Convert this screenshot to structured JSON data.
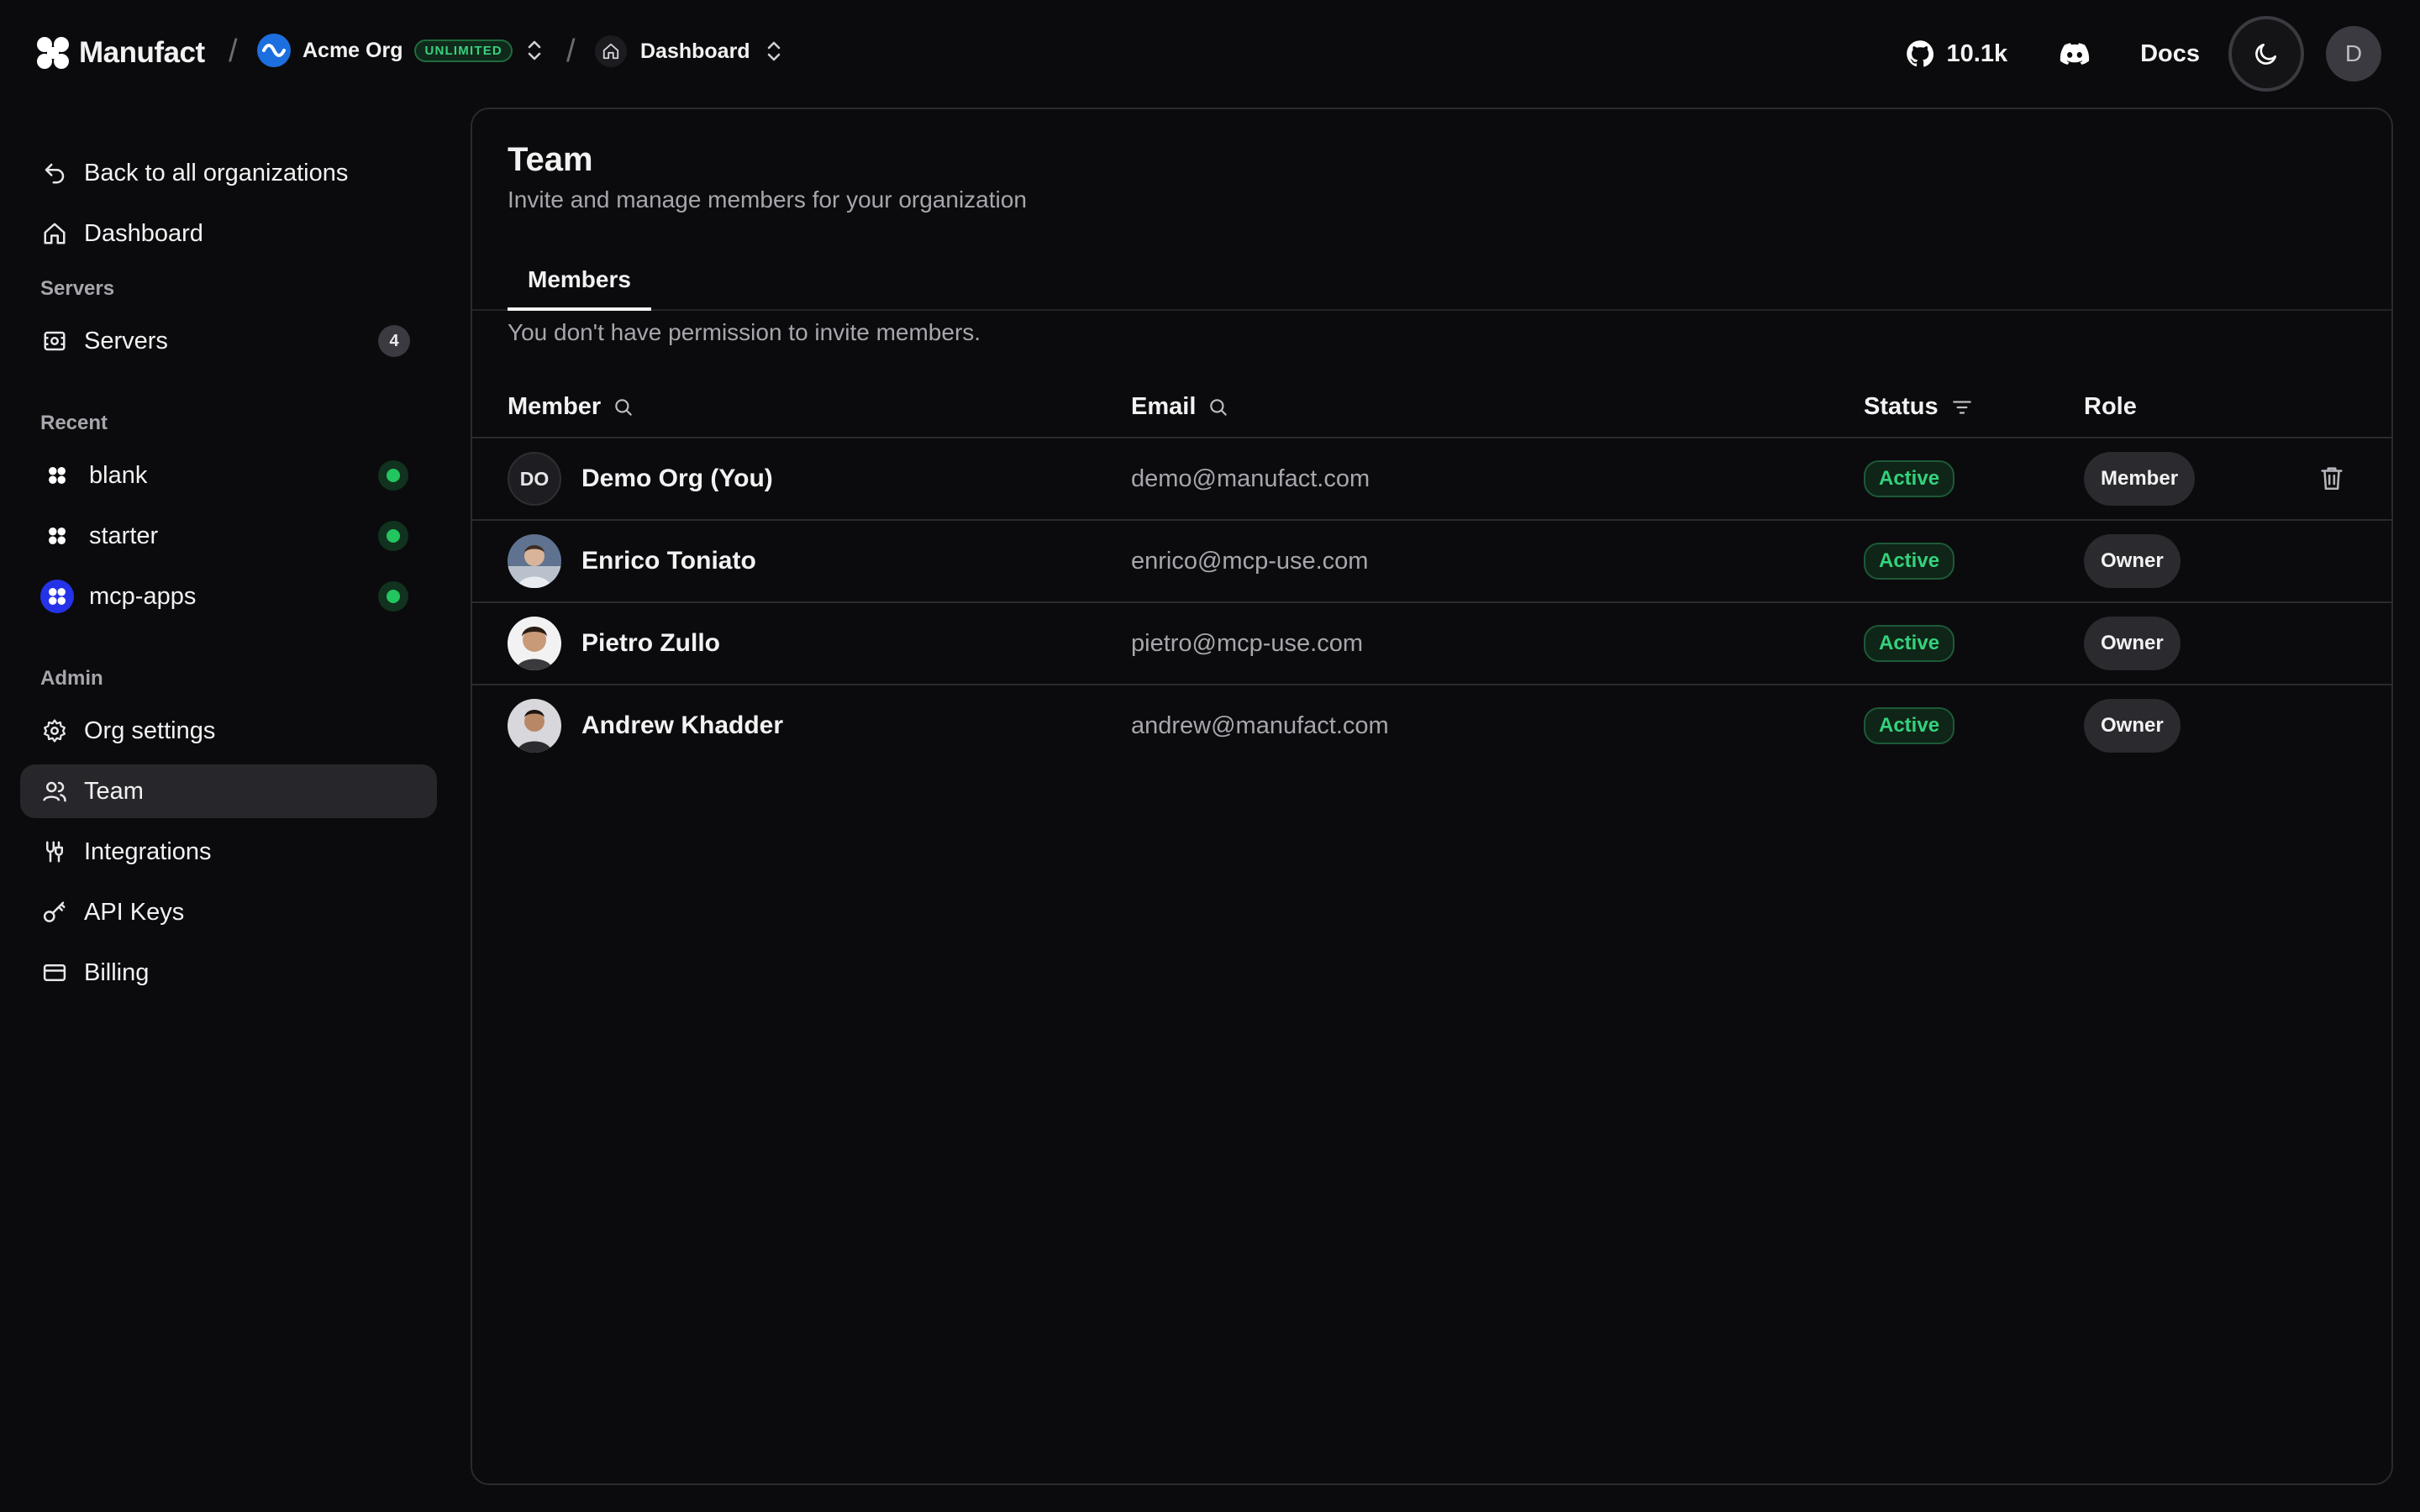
{
  "header": {
    "brand": "Manufact",
    "separator": "/",
    "org_name": "Acme Org",
    "plan_badge": "UNLIMITED",
    "crumb": "Dashboard",
    "github_stars": "10.1k",
    "docs_label": "Docs",
    "user_initial": "D"
  },
  "sidebar": {
    "back_label": "Back to all organizations",
    "dashboard_label": "Dashboard",
    "servers_section": "Servers",
    "servers_label": "Servers",
    "servers_count": "4",
    "recent_section": "Recent",
    "recent": [
      {
        "label": "blank"
      },
      {
        "label": "starter"
      },
      {
        "label": "mcp-apps"
      }
    ],
    "admin_section": "Admin",
    "admin": [
      {
        "label": "Org settings",
        "icon": "gear-icon"
      },
      {
        "label": "Team",
        "icon": "users-icon"
      },
      {
        "label": "Integrations",
        "icon": "integrations-icon"
      },
      {
        "label": "API Keys",
        "icon": "key-icon"
      },
      {
        "label": "Billing",
        "icon": "credit-card-icon"
      }
    ]
  },
  "main": {
    "title": "Team",
    "subtitle": "Invite and manage members for your organization",
    "tab": "Members",
    "permission_note": "You don't have permission to invite members.",
    "columns": {
      "member": "Member",
      "email": "Email",
      "status": "Status",
      "role": "Role"
    },
    "members": [
      {
        "initials": "DO",
        "name": "Demo Org (You)",
        "email": "demo@manufact.com",
        "status": "Active",
        "role": "Member"
      },
      {
        "name": "Enrico Toniato",
        "email": "enrico@mcp-use.com",
        "status": "Active",
        "role": "Owner"
      },
      {
        "name": "Pietro Zullo",
        "email": "pietro@mcp-use.com",
        "status": "Active",
        "role": "Owner"
      },
      {
        "name": "Andrew Khadder",
        "email": "andrew@manufact.com",
        "status": "Active",
        "role": "Owner"
      }
    ]
  },
  "colors": {
    "background": "#0b0b0d",
    "active_green": "#34d27c",
    "org_blue": "#1d6fe0"
  }
}
